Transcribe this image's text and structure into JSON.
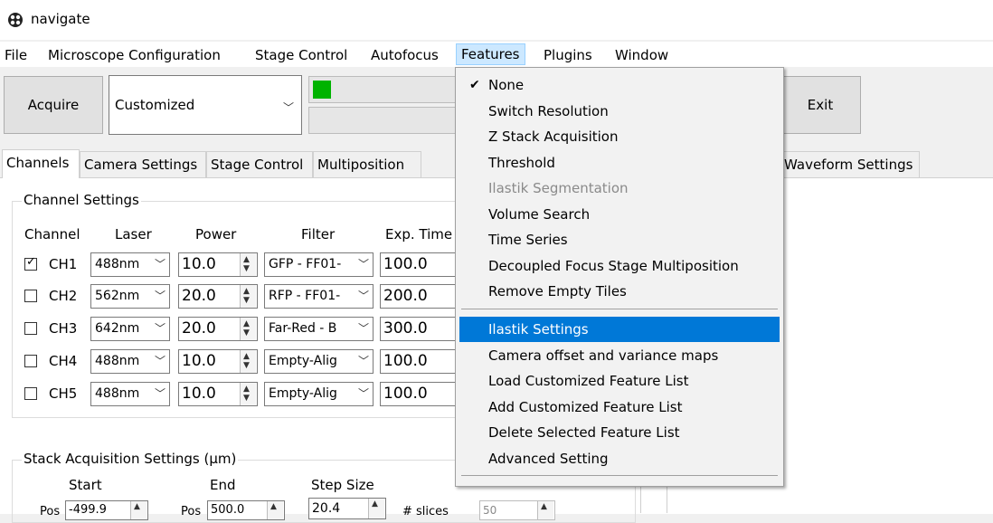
{
  "window": {
    "title": "navigate"
  },
  "menubar": {
    "items": [
      "File",
      "Microscope Configuration",
      "Stage Control",
      "Autofocus",
      "Features",
      "Plugins",
      "Window"
    ]
  },
  "toolbar": {
    "acquire_label": "Acquire",
    "mode_value": "Customized",
    "exit_label": "Exit",
    "status_color": "#00b300"
  },
  "tabs": {
    "left": [
      "Channels",
      "Camera Settings",
      "Stage Control",
      "Multiposition"
    ],
    "right": [
      "Waveform Settings"
    ]
  },
  "channel_settings": {
    "title": "Channel Settings",
    "headers": [
      "Channel",
      "Laser",
      "Power",
      "Filter",
      "Exp. Time"
    ],
    "rows": [
      {
        "checked": true,
        "name": "CH1",
        "laser": "488nm",
        "power": "10.0",
        "filter": "GFP - FF01-",
        "exp": "100.0"
      },
      {
        "checked": false,
        "name": "CH2",
        "laser": "562nm",
        "power": "20.0",
        "filter": "RFP - FF01-",
        "exp": "200.0"
      },
      {
        "checked": false,
        "name": "CH3",
        "laser": "642nm",
        "power": "20.0",
        "filter": "Far-Red - B",
        "exp": "300.0"
      },
      {
        "checked": false,
        "name": "CH4",
        "laser": "488nm",
        "power": "10.0",
        "filter": "Empty-Alig",
        "exp": "100.0"
      },
      {
        "checked": false,
        "name": "CH5",
        "laser": "488nm",
        "power": "10.0",
        "filter": "Empty-Alig",
        "exp": "100.0"
      }
    ]
  },
  "stack_settings": {
    "title": "Stack Acquisition Settings (µm)",
    "start_label": "Start",
    "end_label": "End",
    "step_label": "Step Size",
    "pos_label": "Pos",
    "start_value": "-499.9",
    "end_value": "500.0",
    "step_value": "20.4",
    "slices_label": "# slices",
    "slices_value": "50"
  },
  "features_menu": {
    "items": [
      {
        "label": "None",
        "checked": true,
        "disabled": false,
        "highlighted": false
      },
      {
        "label": "Switch Resolution",
        "checked": false,
        "disabled": false,
        "highlighted": false
      },
      {
        "label": "Z Stack Acquisition",
        "checked": false,
        "disabled": false,
        "highlighted": false
      },
      {
        "label": "Threshold",
        "checked": false,
        "disabled": false,
        "highlighted": false
      },
      {
        "label": "Ilastik Segmentation",
        "checked": false,
        "disabled": true,
        "highlighted": false
      },
      {
        "label": "Volume Search",
        "checked": false,
        "disabled": false,
        "highlighted": false
      },
      {
        "label": "Time Series",
        "checked": false,
        "disabled": false,
        "highlighted": false
      },
      {
        "label": "Decoupled Focus Stage Multiposition",
        "checked": false,
        "disabled": false,
        "highlighted": false
      },
      {
        "label": "Remove Empty Tiles",
        "checked": false,
        "disabled": false,
        "highlighted": false
      },
      {
        "label": "Ilastik Settings",
        "checked": false,
        "disabled": false,
        "highlighted": true
      },
      {
        "label": "Camera offset and variance maps",
        "checked": false,
        "disabled": false,
        "highlighted": false
      },
      {
        "label": "Load Customized Feature List",
        "checked": false,
        "disabled": false,
        "highlighted": false
      },
      {
        "label": "Add Customized Feature List",
        "checked": false,
        "disabled": false,
        "highlighted": false
      },
      {
        "label": "Delete Selected Feature List",
        "checked": false,
        "disabled": false,
        "highlighted": false
      },
      {
        "label": "Advanced Setting",
        "checked": false,
        "disabled": false,
        "highlighted": false
      }
    ]
  }
}
